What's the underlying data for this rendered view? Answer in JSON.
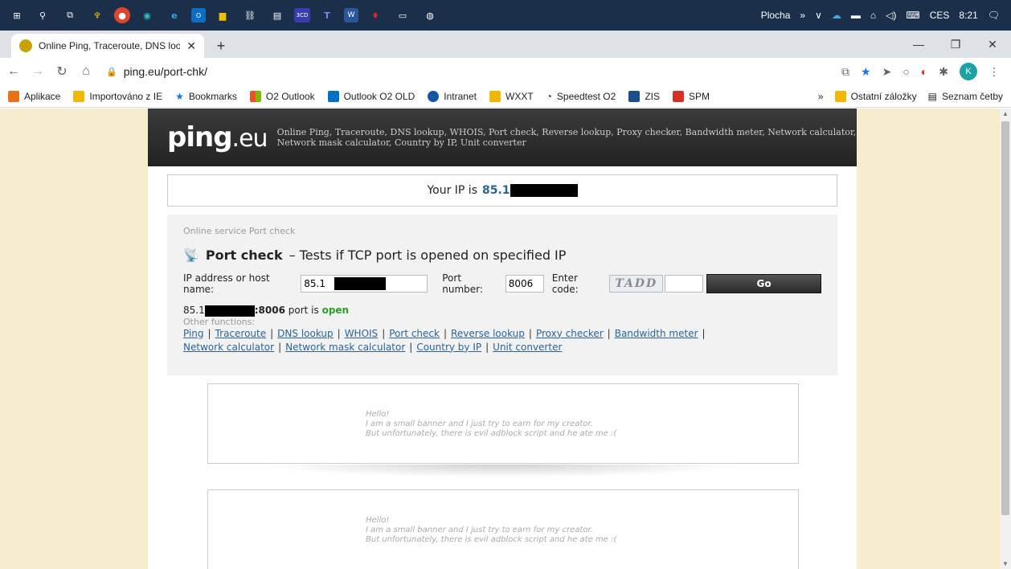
{
  "taskbar": {
    "right": {
      "desktop": "Plocha",
      "chevron": "»",
      "lang": "CES",
      "time": "8:21"
    }
  },
  "browser": {
    "tab": {
      "title": "Online Ping, Traceroute, DNS loo",
      "close": "✕"
    },
    "new_tab": "+",
    "window": {
      "minimize": "—",
      "maximize": "❐",
      "close": "✕"
    },
    "url": "ping.eu/port-chk/",
    "bookmarks": [
      {
        "label": "Aplikace",
        "color": "#e8711a"
      },
      {
        "label": "Importováno z IE",
        "color": "#f2b700"
      },
      {
        "label": "Bookmarks",
        "color": "#1a73e8"
      },
      {
        "label": "O2 Outlook",
        "color": "#f25022"
      },
      {
        "label": "Outlook O2 OLD",
        "color": "#0072c6"
      },
      {
        "label": "Intranet",
        "color": "#1557a0"
      },
      {
        "label": "WXXT",
        "color": "#f2b700"
      },
      {
        "label": "Speedtest O2",
        "color": "#444444"
      },
      {
        "label": "ZIS",
        "color": "#1f4e8c"
      },
      {
        "label": "SPM",
        "color": "#d93025"
      }
    ],
    "bookmarks_more": "»",
    "other_bookmarks": "Ostatní záložky",
    "reading_list": "Seznam četby"
  },
  "site": {
    "logo_main": "ping",
    "logo_suffix": ".eu",
    "tagline": "Online Ping, Traceroute, DNS lookup, WHOIS, Port check, Reverse lookup, Proxy checker, Bandwidth meter, Network calculator, Network mask calculator, Country by IP, Unit converter",
    "ip_label": "Your IP is",
    "ip_value": "85.1",
    "service_label": "Online service Port check",
    "service_title": "Port check",
    "service_desc": "– Tests if TCP port is opened on specified IP",
    "form": {
      "host_label": "IP address or host name:",
      "host_value": "85.1",
      "port_label": "Port number:",
      "port_value": "8006",
      "code_label": "Enter code:",
      "captcha": "TADD",
      "code_value": "",
      "go": "Go"
    },
    "result": {
      "ip": "85.1",
      "port_text": ":8006",
      "mid": "port is",
      "status": "open"
    },
    "other_label": "Other functions:",
    "links": [
      "Ping",
      "Traceroute",
      "DNS lookup",
      "WHOIS",
      "Port check",
      "Reverse lookup",
      "Proxy checker",
      "Bandwidth meter",
      "Network calculator",
      "Network mask calculator",
      "Country by IP",
      "Unit converter"
    ],
    "banner": {
      "l1": "Hello!",
      "l2": "I am a small banner and I just try to earn for my creator.",
      "l3": "But unfortunately, there is evil adblock script and he ate me :("
    }
  }
}
